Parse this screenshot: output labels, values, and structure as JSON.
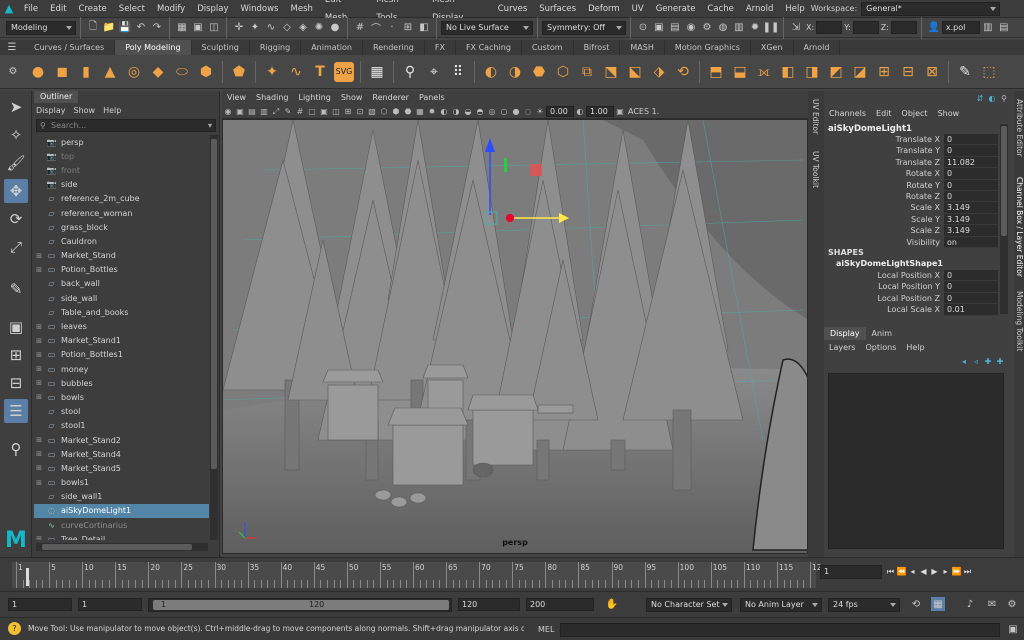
{
  "app": {
    "logo_letter": "M"
  },
  "menubar": {
    "items": [
      "File",
      "Edit",
      "Create",
      "Select",
      "Modify",
      "Display",
      "Windows",
      "Mesh",
      "Edit Mesh",
      "Mesh Tools",
      "Mesh Display",
      "Curves",
      "Surfaces",
      "Deform",
      "UV",
      "Generate",
      "Cache",
      "Arnold",
      "Help"
    ],
    "workspace_label": "Workspace:",
    "workspace_value": "General*"
  },
  "statusline": {
    "mode": "Modeling",
    "live_surface": "No Live Surface",
    "symmetry": "Symmetry: Off",
    "x_label": "X:",
    "y_label": "Y:",
    "z_label": "Z:",
    "search_value": "x.pol"
  },
  "shelf": {
    "tabs": [
      "Curves / Surfaces",
      "Poly Modeling",
      "Sculpting",
      "Rigging",
      "Animation",
      "Rendering",
      "FX",
      "FX Caching",
      "Custom",
      "Bifrost",
      "MASH",
      "Motion Graphics",
      "XGen",
      "Arnold"
    ],
    "active_tab": "Poly Modeling"
  },
  "outliner": {
    "tab": "Outliner",
    "menu": [
      "Display",
      "Show",
      "Help"
    ],
    "search_placeholder": "Search...",
    "rows": [
      {
        "label": "persp",
        "kind": "camera",
        "state": "normal",
        "exp": false
      },
      {
        "label": "top",
        "kind": "camera",
        "state": "dim",
        "exp": false
      },
      {
        "label": "front",
        "kind": "camera",
        "state": "dim",
        "exp": false
      },
      {
        "label": "side",
        "kind": "camera",
        "state": "normal",
        "exp": false
      },
      {
        "label": "reference_2m_cube",
        "kind": "mesh",
        "state": "normal",
        "exp": false
      },
      {
        "label": "reference_woman",
        "kind": "mesh",
        "state": "normal",
        "exp": false
      },
      {
        "label": "grass_block",
        "kind": "mesh",
        "state": "normal",
        "exp": false
      },
      {
        "label": "Cauldron",
        "kind": "mesh",
        "state": "normal",
        "exp": false
      },
      {
        "label": "Market_Stand",
        "kind": "group",
        "state": "normal",
        "exp": true
      },
      {
        "label": "Potion_Bottles",
        "kind": "group",
        "state": "normal",
        "exp": true
      },
      {
        "label": "back_wall",
        "kind": "mesh",
        "state": "normal",
        "exp": false
      },
      {
        "label": "side_wall",
        "kind": "mesh",
        "state": "normal",
        "exp": false
      },
      {
        "label": "Table_and_books",
        "kind": "mesh",
        "state": "normal",
        "exp": false
      },
      {
        "label": "leaves",
        "kind": "group",
        "state": "normal",
        "exp": true
      },
      {
        "label": "Market_Stand1",
        "kind": "group",
        "state": "normal",
        "exp": true
      },
      {
        "label": "Potion_Bottles1",
        "kind": "group",
        "state": "normal",
        "exp": true
      },
      {
        "label": "money",
        "kind": "group",
        "state": "normal",
        "exp": true
      },
      {
        "label": "bubbles",
        "kind": "group",
        "state": "normal",
        "exp": true
      },
      {
        "label": "bowls",
        "kind": "group",
        "state": "normal",
        "exp": true
      },
      {
        "label": "stool",
        "kind": "mesh",
        "state": "normal",
        "exp": false
      },
      {
        "label": "stool1",
        "kind": "mesh",
        "state": "normal",
        "exp": false
      },
      {
        "label": "Market_Stand2",
        "kind": "group",
        "state": "normal",
        "exp": true
      },
      {
        "label": "Market_Stand4",
        "kind": "group",
        "state": "normal",
        "exp": true
      },
      {
        "label": "Market_Stand5",
        "kind": "group",
        "state": "normal",
        "exp": true
      },
      {
        "label": "bowls1",
        "kind": "group",
        "state": "normal",
        "exp": true
      },
      {
        "label": "side_wall1",
        "kind": "mesh",
        "state": "normal",
        "exp": false
      },
      {
        "label": "aiSkyDomeLight1",
        "kind": "light",
        "state": "selected",
        "exp": false
      },
      {
        "label": "curveCortinarius",
        "kind": "curve",
        "state": "curve",
        "exp": false
      },
      {
        "label": "Tree_Detail",
        "kind": "group",
        "state": "normal",
        "exp": true
      }
    ]
  },
  "viewport": {
    "menu": [
      "View",
      "Shading",
      "Lighting",
      "Show",
      "Renderer",
      "Panels"
    ],
    "exposure": "0.00",
    "gamma": "1.00",
    "color_space": "ACES 1.",
    "camera_label": "persp"
  },
  "side_tabs": {
    "vp_right_1": "UV Editor",
    "vp_right_2": "UV Toolkit",
    "far_1": "Attribute Editor",
    "far_2": "Channel Box / Layer Editor",
    "far_3": "Modeling Toolkit"
  },
  "channelbox": {
    "menu": [
      "Channels",
      "Edit",
      "Object",
      "Show"
    ],
    "node": "aiSkyDomeLight1",
    "attrs": [
      {
        "name": "Translate X",
        "value": "0"
      },
      {
        "name": "Translate Y",
        "value": "0"
      },
      {
        "name": "Translate Z",
        "value": "11.082"
      },
      {
        "name": "Rotate X",
        "value": "0"
      },
      {
        "name": "Rotate Y",
        "value": "0"
      },
      {
        "name": "Rotate Z",
        "value": "0"
      },
      {
        "name": "Scale X",
        "value": "3.149"
      },
      {
        "name": "Scale Y",
        "value": "3.149"
      },
      {
        "name": "Scale Z",
        "value": "3.149"
      },
      {
        "name": "Visibility",
        "value": "on"
      }
    ],
    "shapes_header": "SHAPES",
    "shape_node": "aiSkyDomeLightShape1",
    "shape_attrs": [
      {
        "name": "Local Position X",
        "value": "0"
      },
      {
        "name": "Local Position Y",
        "value": "0"
      },
      {
        "name": "Local Position Z",
        "value": "0"
      },
      {
        "name": "Local Scale X",
        "value": "0.01"
      }
    ]
  },
  "layer_editor": {
    "tabs": [
      "Display",
      "Anim"
    ],
    "active_tab": "Display",
    "menu": [
      "Layers",
      "Options",
      "Help"
    ]
  },
  "timeline": {
    "ticks": [
      "1",
      "5",
      "10",
      "15",
      "20",
      "25",
      "30",
      "35",
      "40",
      "45",
      "50",
      "55",
      "60",
      "65",
      "70",
      "75",
      "80",
      "85",
      "90",
      "95",
      "100",
      "105",
      "110",
      "115",
      "12"
    ],
    "current_frame": "1"
  },
  "range": {
    "start": "1",
    "playback_start": "1",
    "slider_start": "1",
    "slider_end": "120",
    "playback_end": "120",
    "end": "200",
    "character_set": "No Character Set",
    "anim_layer": "No Anim Layer",
    "fps": "24 fps"
  },
  "helpline": {
    "text": "Move Tool: Use manipulator to move object(s). Ctrl+middle-drag to move components along normals. Shift+drag manipulator axis or plane ha",
    "mel_label": "MEL"
  }
}
